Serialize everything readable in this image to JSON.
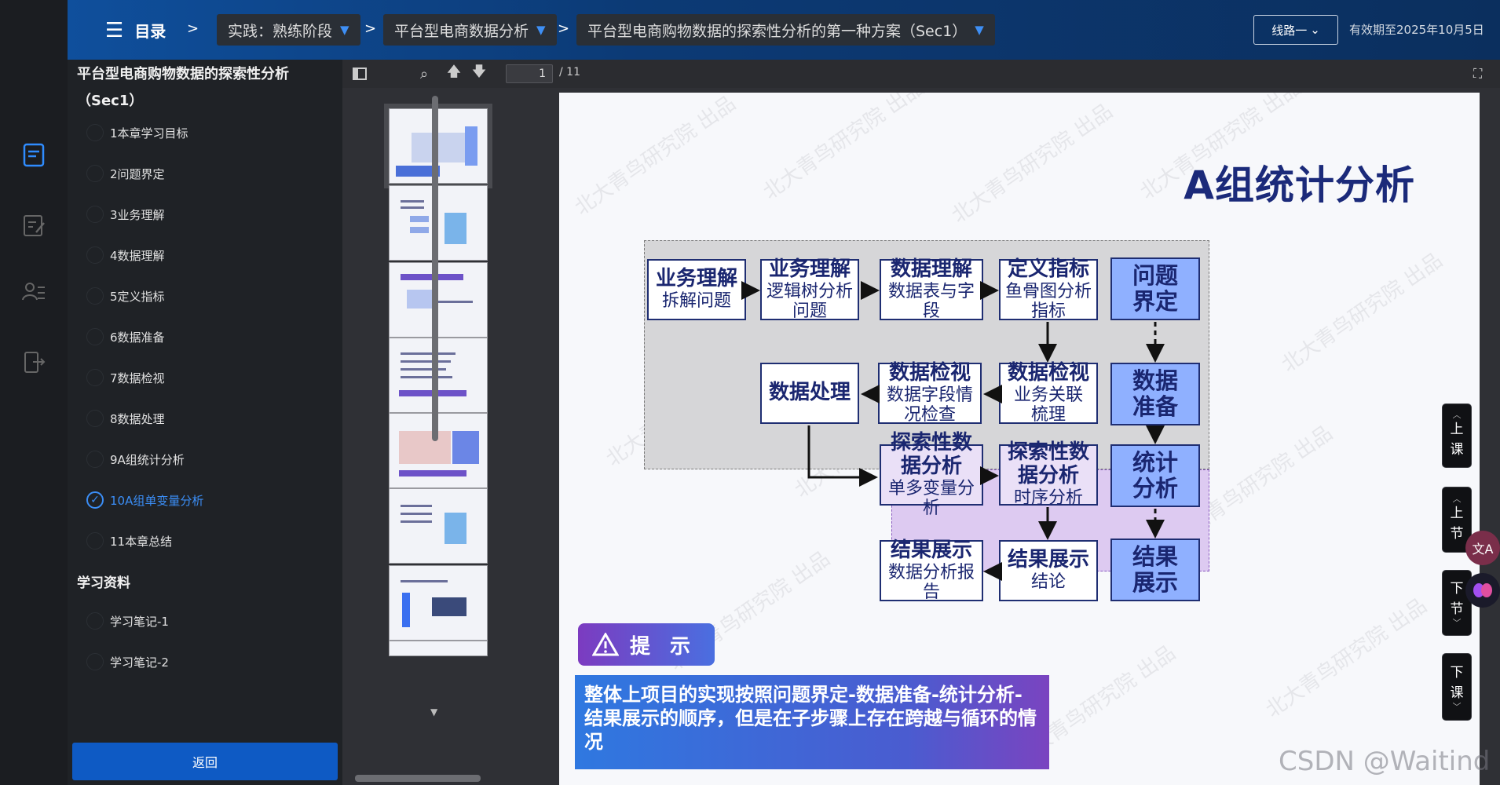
{
  "topbar": {
    "menu_label": "目录",
    "sep": ">",
    "crumbs": [
      "实践：熟练阶段",
      "平台型电商数据分析",
      "平台型电商购物数据的探索性分析的第一种方案（Sec1）"
    ],
    "caret": "▼",
    "route_label": "线路一",
    "validity": "有效期至2025年10月5日"
  },
  "sidebar": {
    "title": "平台型电商购物数据的探索性分析（Sec1）",
    "items": [
      {
        "label": "1本章学习目标",
        "checked": false
      },
      {
        "label": "2问题界定",
        "checked": false
      },
      {
        "label": "3业务理解",
        "checked": false
      },
      {
        "label": "4数据理解",
        "checked": false
      },
      {
        "label": "5定义指标",
        "checked": false
      },
      {
        "label": "6数据准备",
        "checked": false
      },
      {
        "label": "7数据检视",
        "checked": false
      },
      {
        "label": "8数据处理",
        "checked": false
      },
      {
        "label": "9A组统计分析",
        "checked": false
      },
      {
        "label": "10A组单变量分析",
        "checked": true
      },
      {
        "label": "11本章总结",
        "checked": false
      }
    ],
    "section_materials": "学习资料",
    "materials": [
      {
        "label": "学习笔记-1"
      },
      {
        "label": "学习笔记-2"
      }
    ],
    "back_label": "返回"
  },
  "pdf_toolbar": {
    "page_current": "1",
    "page_total": "/ 11"
  },
  "slide": {
    "title": "A组统计分析",
    "boxes": {
      "b1_h": "业务理解",
      "b1_s": "拆解问题",
      "b2_h": "业务理解",
      "b2_s": "逻辑树分析问题",
      "b3_h": "数据理解",
      "b3_s": "数据表与字段",
      "b4_h": "定义指标",
      "b4_s": "鱼骨图分析指标",
      "b5_h": "数据处理",
      "b6_h": "数据检视",
      "b6_s": "数据字段情况检查",
      "b7_h": "数据检视",
      "b7_s": "业务关联梳理",
      "b8_h": "探索性数据分析",
      "b8_s": "单多变量分析",
      "b9_h": "探索性数据分析",
      "b9_s": "时序分析",
      "b10_h": "结果展示",
      "b10_s": "数据分析报告",
      "b11_h": "结果展示",
      "b11_s": "结论"
    },
    "steps": [
      "问题界定",
      "数据准备",
      "统计分析",
      "结果展示"
    ],
    "hint_label": "提 示",
    "summary": "整体上项目的实现按照问题界定-数据准备-统计分析-结果展示的顺序，但是在子步骤上存在跨越与循环的情况",
    "watermark": "北大青鸟研究院 出品"
  },
  "side_buttons": [
    "上课",
    "上节",
    "下节",
    "下课"
  ],
  "fab_translate": "文A",
  "csdn_mark": "CSDN @Waitind",
  "colors": {
    "accent": "#3b8ef6",
    "topbar": "#0f4f9c",
    "step_blue": "#8fb0ff",
    "navy": "#1f2e72"
  }
}
